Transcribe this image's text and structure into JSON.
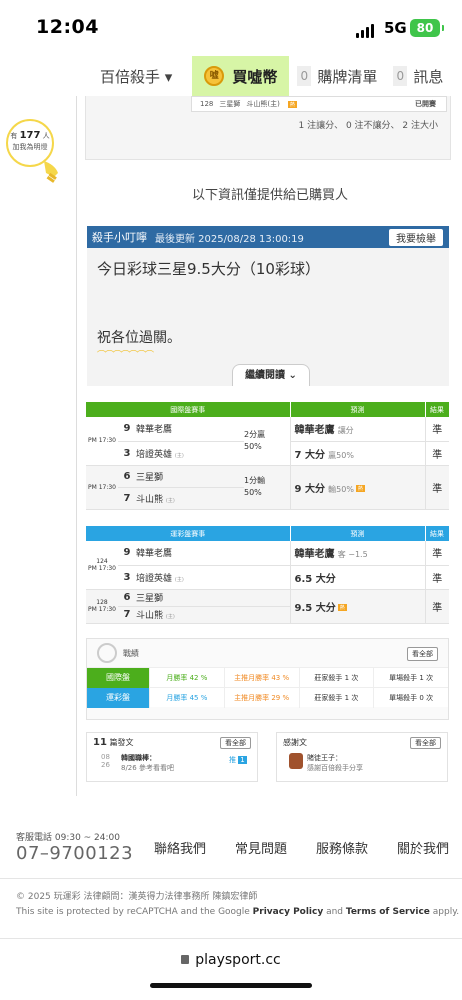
{
  "status_bar": {
    "time": "12:04",
    "network": "5G",
    "battery": "80"
  },
  "nav": {
    "killer": "百倍殺手 ▾",
    "buy": "買噓幣",
    "cart_count": "0",
    "cart": "購牌清單",
    "msg_count": "0",
    "msg": "訊息"
  },
  "fans": {
    "prefix": "有",
    "count": "177",
    "suffix": "人",
    "line2": "加我為明燈"
  },
  "mini_row": {
    "id": "128",
    "team": "三星獅",
    "team2": "斗山熊(主)",
    "status": "已開賽"
  },
  "stats_line": "1 注讓分、 0 注不讓分、 2 注大小",
  "info_notice": "以下資訊僅提供給已購買人",
  "tip": {
    "title": "殺手小叮嚀",
    "updated": "最後更新 2025/08/28 13:00:19",
    "report": "我要檢舉",
    "line1": "今日彩球三星9.5大分（10彩球）",
    "line2": "祝各位過關。",
    "continue": "繼續閱讀 ⌄"
  },
  "intl_table": {
    "header": [
      "國際盤賽事",
      "預測",
      "結果"
    ],
    "rows": [
      {
        "time": "PM 17:30",
        "num1": "9",
        "team1": "韓華老鷹",
        "num2": "3",
        "team2": "培證英雄",
        "home_mark": "(主)",
        "odds1": "2分贏",
        "odds2": "50%",
        "pred1": "韓華老鷹",
        "pred1_note": "讓分",
        "pred2": "7 大分",
        "pred2_note": "贏50%",
        "res1": "準",
        "res2": "準"
      },
      {
        "time": "PM 17:30",
        "num1": "6",
        "team1": "三星獅",
        "num2": "7",
        "team2": "斗山熊",
        "home_mark": "(主)",
        "odds1": "1分輸",
        "odds2": "50%",
        "pred1": "9 大分",
        "pred1_note": "輸50%",
        "res1": "準"
      }
    ]
  },
  "lottery_table": {
    "header": [
      "運彩盤賽事",
      "預測",
      "結果"
    ],
    "rows": [
      {
        "id": "124",
        "time": "PM 17:30",
        "num1": "9",
        "team1": "韓華老鷹",
        "num2": "3",
        "team2": "培證英雄",
        "home_mark": "(主)",
        "pred1": "韓華老鷹",
        "pred1_note": "客 −1.5",
        "pred2": "6.5 大分",
        "res1": "準",
        "res2": "準"
      },
      {
        "id": "128",
        "time": "PM 17:30",
        "num1": "6",
        "team1": "三星獅",
        "num2": "7",
        "team2": "斗山熊",
        "home_mark": "(主)",
        "pred1": "9.5 大分",
        "res1": "準"
      }
    ]
  },
  "record": {
    "title": "戰績",
    "all": "看全部",
    "rows": [
      {
        "label": "國際盤",
        "month": "月勝率 42 %",
        "home": "主推月勝率 43 %",
        "dealer": "莊家殺手 1 次",
        "single": "單場殺手 1 次"
      },
      {
        "label": "運彩盤",
        "month": "月勝率 45 %",
        "home": "主推月勝率 29 %",
        "dealer": "莊家殺手 1 次",
        "single": "單場殺手 0 次"
      }
    ]
  },
  "posts": {
    "count": "11",
    "title": "篇發文",
    "all": "看全部",
    "date_m": "08",
    "date_d": "26",
    "post_title": "韓國職棒：",
    "post_sub": "8/26 參考看看吧",
    "push": "推",
    "push_n": "1"
  },
  "thanks": {
    "title": "感謝文",
    "all": "看全部",
    "author": "賭徒王子：",
    "text": "感謝百倍殺手分享"
  },
  "footer": {
    "service": "客服電話 09:30 ~ 24:00",
    "phone": "07–9700123",
    "links": [
      "聯絡我們",
      "常見問題",
      "服務條款",
      "關於我們"
    ],
    "copyright": "© 2025 玩運彩 法律顧問：漢英得力法律事務所 陳鎮宏律師",
    "captcha_a": "This site is protected by reCAPTCHA and the Google ",
    "captcha_pp": "Privacy Policy",
    "captcha_and": " and ",
    "captcha_tos": "Terms of Service",
    "captcha_b": " apply.",
    "url": "playsport.cc"
  },
  "colors": {
    "intl_green": "#4cae1c",
    "lottery_blue": "#2aa4e2",
    "tip_blue": "#2e6aa3",
    "buy_bg": "#d7f5a6",
    "ok_green": "#2aa84a"
  }
}
